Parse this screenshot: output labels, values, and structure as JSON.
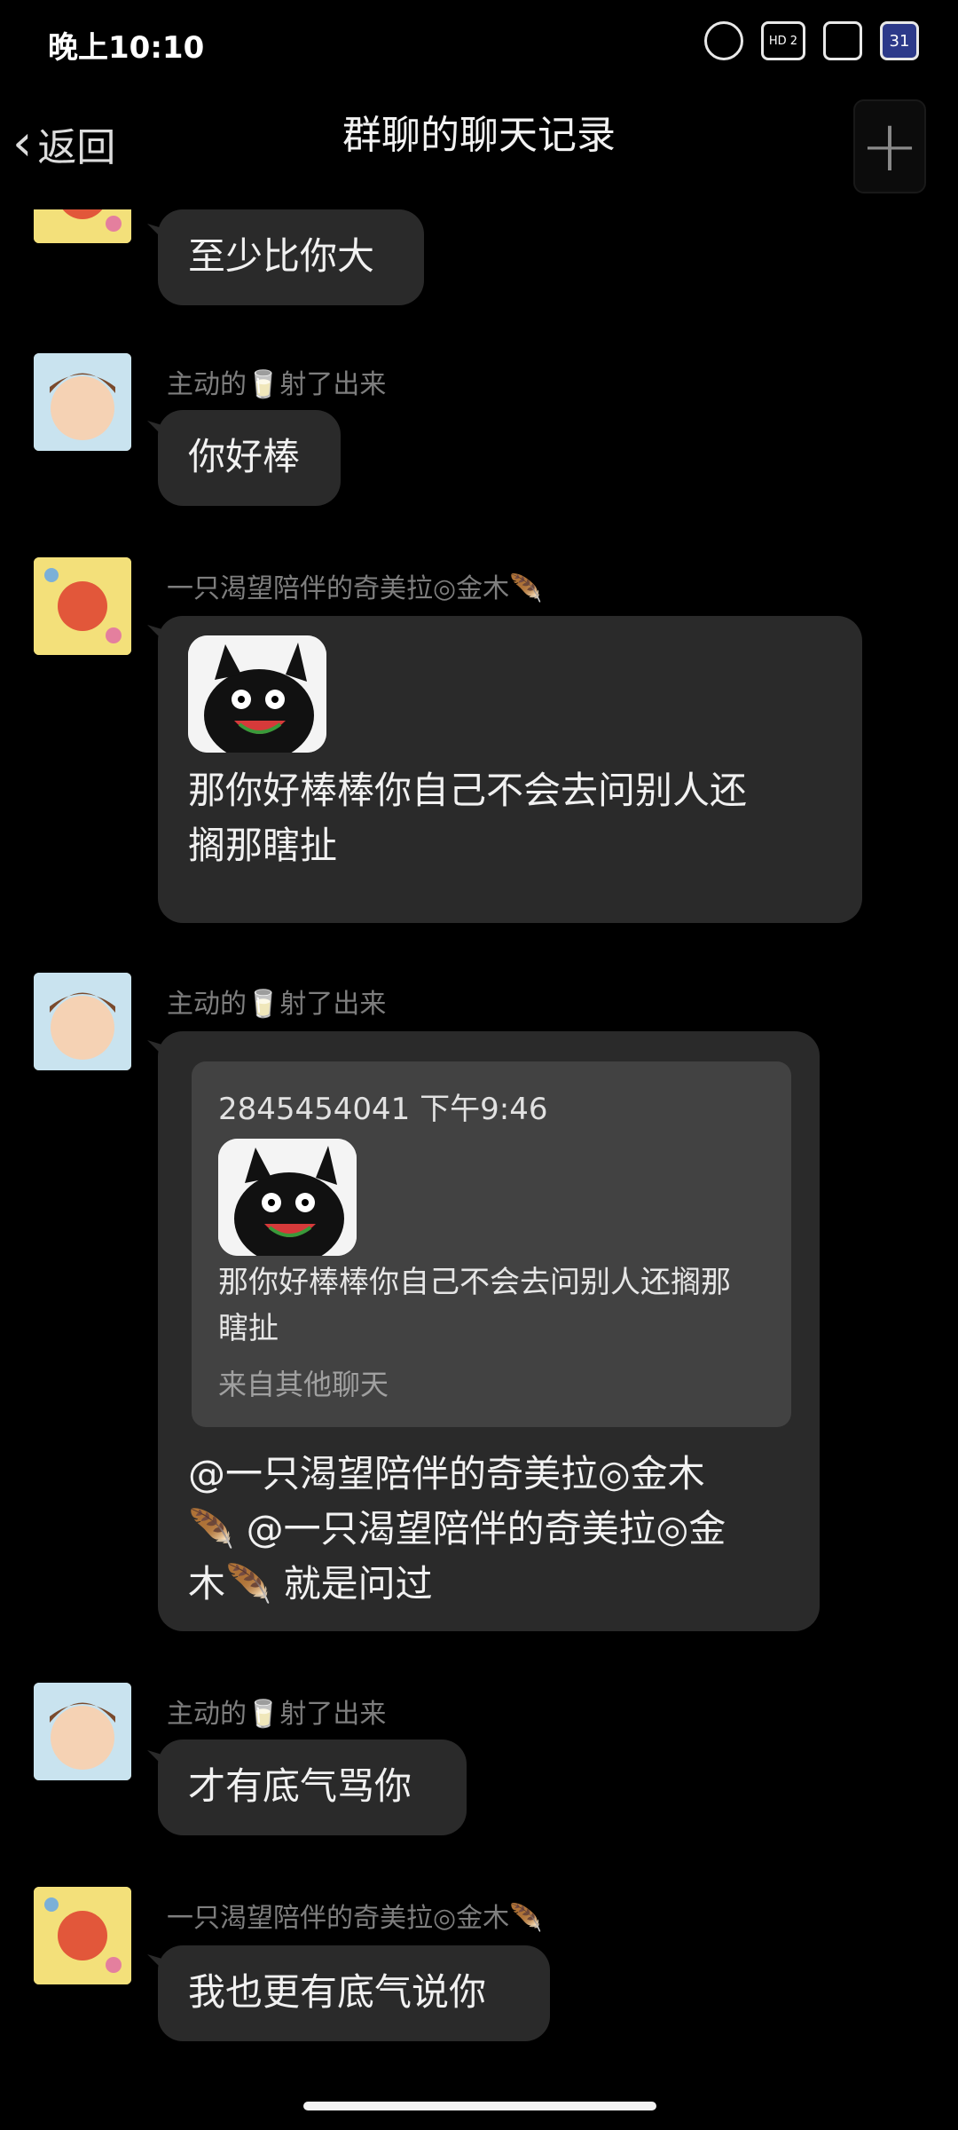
{
  "status_bar": {
    "time": "晚上10:10",
    "icons": [
      "alarm-icon",
      "hd-signal-icon",
      "wifi-icon",
      "calendar-icon"
    ],
    "hd_label": "HD 2",
    "calendar_day": "31"
  },
  "header": {
    "back_label": "返回",
    "title": "群聊的聊天记录",
    "plus_icon": "+"
  },
  "messages": [
    {
      "sender": "",
      "avatar": "fox",
      "text": "至少比你大"
    },
    {
      "sender": "主动的🥛射了出来",
      "avatar": "boy",
      "text": "你好棒"
    },
    {
      "sender": "一只渴望陪伴的奇美拉◎金木🪶",
      "avatar": "fox",
      "has_image": true,
      "text": "那你好棒棒你自己不会去问别人还\n搁那瞎扯"
    },
    {
      "sender": "主动的🥛射了出来",
      "avatar": "boy",
      "quote": {
        "meta": "2845454041 下午9:46",
        "text": "那你好棒棒你自己不会去问别人还搁那\n瞎扯",
        "source": "来自其他聊天"
      },
      "text": "@一只渴望陪伴的奇美拉◎金木\n🪶 @一只渴望陪伴的奇美拉◎金\n木🪶 就是问过"
    },
    {
      "sender": "主动的🥛射了出来",
      "avatar": "boy",
      "text": "才有底气骂你"
    },
    {
      "sender": "一只渴望陪伴的奇美拉◎金木🪶",
      "avatar": "fox",
      "text": "我也更有底气说你"
    }
  ],
  "colors": {
    "background": "#000000",
    "bubble": "#2a2a2a",
    "quote_bg": "#424242",
    "sender_text": "#7e7e7e"
  }
}
